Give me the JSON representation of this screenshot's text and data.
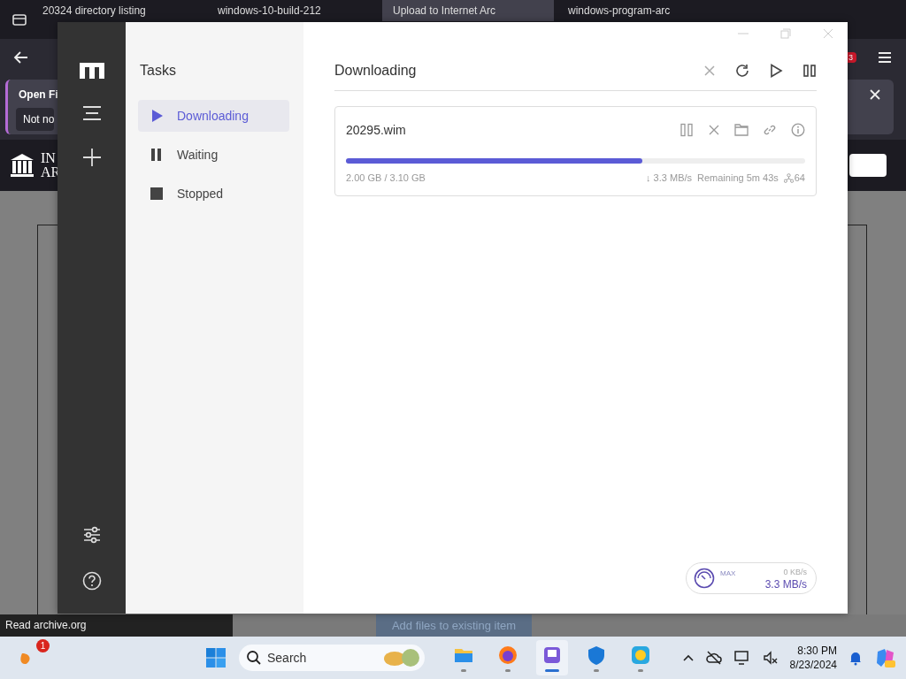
{
  "browser": {
    "tabs": [
      {
        "label": "20324 directory listing",
        "selected": false
      },
      {
        "label": "windows-10-build-212",
        "selected": false
      },
      {
        "label": "Upload to Internet Arc",
        "selected": true
      },
      {
        "label": "windows-program-arc",
        "selected": false
      }
    ],
    "notification": {
      "title": "Open Fi",
      "button": "Not no"
    },
    "logo_text": [
      "IN",
      "AR"
    ],
    "extension_badge": "3",
    "status_text": "Read archive.org",
    "page_button": "Add files to existing item"
  },
  "app": {
    "sidebar_title": "Tasks",
    "categories": [
      {
        "label": "Downloading",
        "kind": "play",
        "selected": true
      },
      {
        "label": "Waiting",
        "kind": "pause",
        "selected": false
      },
      {
        "label": "Stopped",
        "kind": "stop",
        "selected": false
      }
    ],
    "header": "Downloading",
    "tasks": [
      {
        "name": "20295.wim",
        "level": 0.646,
        "progress": "2.00 GB / 3.10 GB",
        "speed": "↓ 3.3 MB/s",
        "remaining": "Remaining 5m 43s",
        "connections": "64"
      }
    ],
    "speed_meter": {
      "label": "MAX",
      "upload": "0 KB/s",
      "download": "3.3 MB/s"
    }
  },
  "taskbar": {
    "notification_badge": "1",
    "search_label": "Search",
    "time": "8:30 PM",
    "date": "8/23/2024",
    "apps": [
      {
        "kind": "folder",
        "selected": false
      },
      {
        "kind": "browser",
        "selected": false
      },
      {
        "kind": "downloader",
        "selected": true
      },
      {
        "kind": "shield",
        "selected": false
      },
      {
        "kind": "tool",
        "selected": false
      }
    ]
  }
}
